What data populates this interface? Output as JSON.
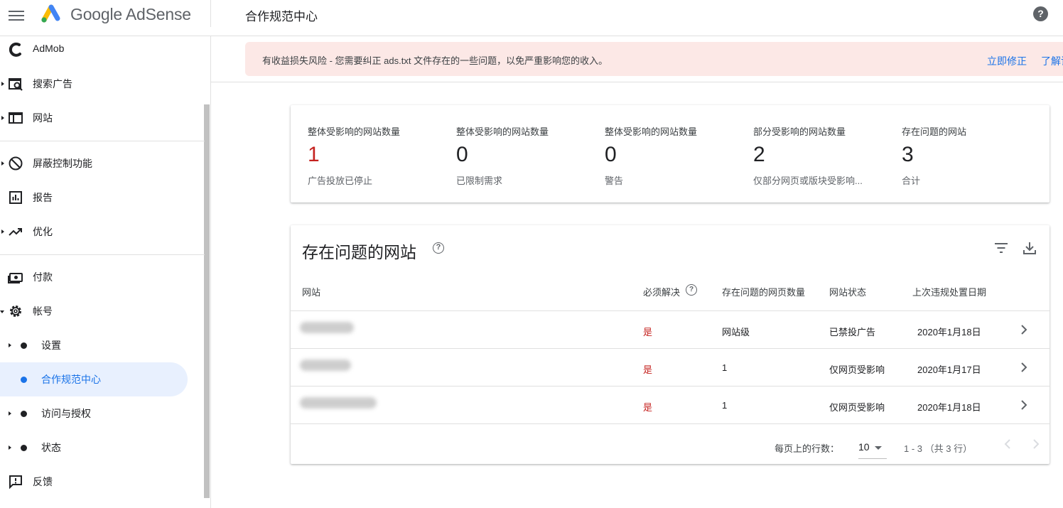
{
  "header": {
    "brand": "Google AdSense",
    "page_title": "合作规范中心",
    "help_glyph": "?"
  },
  "sidebar": {
    "items": [
      {
        "label": "AdMob",
        "icon": "admob-icon"
      },
      {
        "label": "搜索广告",
        "icon": "search-ads-icon"
      },
      {
        "label": "网站",
        "icon": "site-icon"
      },
      {
        "label": "屏蔽控制功能",
        "icon": "block-icon"
      },
      {
        "label": "报告",
        "icon": "report-icon"
      },
      {
        "label": "优化",
        "icon": "trending-icon"
      },
      {
        "label": "付款",
        "icon": "payment-icon"
      },
      {
        "label": "帐号",
        "icon": "gear-icon"
      }
    ],
    "sub_items": [
      {
        "label": "设置"
      },
      {
        "label": "合作规范中心"
      },
      {
        "label": "访问与授权"
      },
      {
        "label": "状态"
      }
    ],
    "feedback": {
      "label": "反馈",
      "icon": "feedback-icon"
    }
  },
  "banner": {
    "text": "有收益损失风险 - 您需要纠正 ads.txt 文件存在的一些问题，以免严重影响您的收入。",
    "fix_label": "立即修正",
    "learn_label": "了解详情"
  },
  "stats": [
    {
      "title": "整体受影响的网站数量",
      "value": "1",
      "subtitle": "广告投放已停止"
    },
    {
      "title": "整体受影响的网站数量",
      "value": "0",
      "subtitle": "已限制需求"
    },
    {
      "title": "整体受影响的网站数量",
      "value": "0",
      "subtitle": "警告"
    },
    {
      "title": "部分受影响的网站数量",
      "value": "2",
      "subtitle": "仅部分网页或版块受影响..."
    },
    {
      "title": "存在问题的网站",
      "value": "3",
      "subtitle": "合计"
    }
  ],
  "table": {
    "title": "存在问题的网站",
    "columns": [
      "网站",
      "必须解决",
      "存在问题的网页数量",
      "网站状态",
      "上次违规处置日期"
    ],
    "rows": [
      {
        "site": "",
        "must_fix": "是",
        "pages": "网站级",
        "status": "已禁投广告",
        "date": "2020年1月18日"
      },
      {
        "site": "",
        "must_fix": "是",
        "pages": "1",
        "status": "仅网页受影响",
        "date": "2020年1月17日"
      },
      {
        "site": "",
        "must_fix": "是",
        "pages": "1",
        "status": "仅网页受影响",
        "date": "2020年1月18日"
      }
    ],
    "footer": {
      "rows_per_page_label": "每页上的行数：",
      "rows_per_page_value": "10",
      "range_text": "1 - 3 （共 3 行）"
    }
  },
  "colors": {
    "accent": "#1a73e8",
    "danger": "#c5221f",
    "banner_bg": "#fce8e6",
    "active_bg": "#e8f0fe"
  }
}
